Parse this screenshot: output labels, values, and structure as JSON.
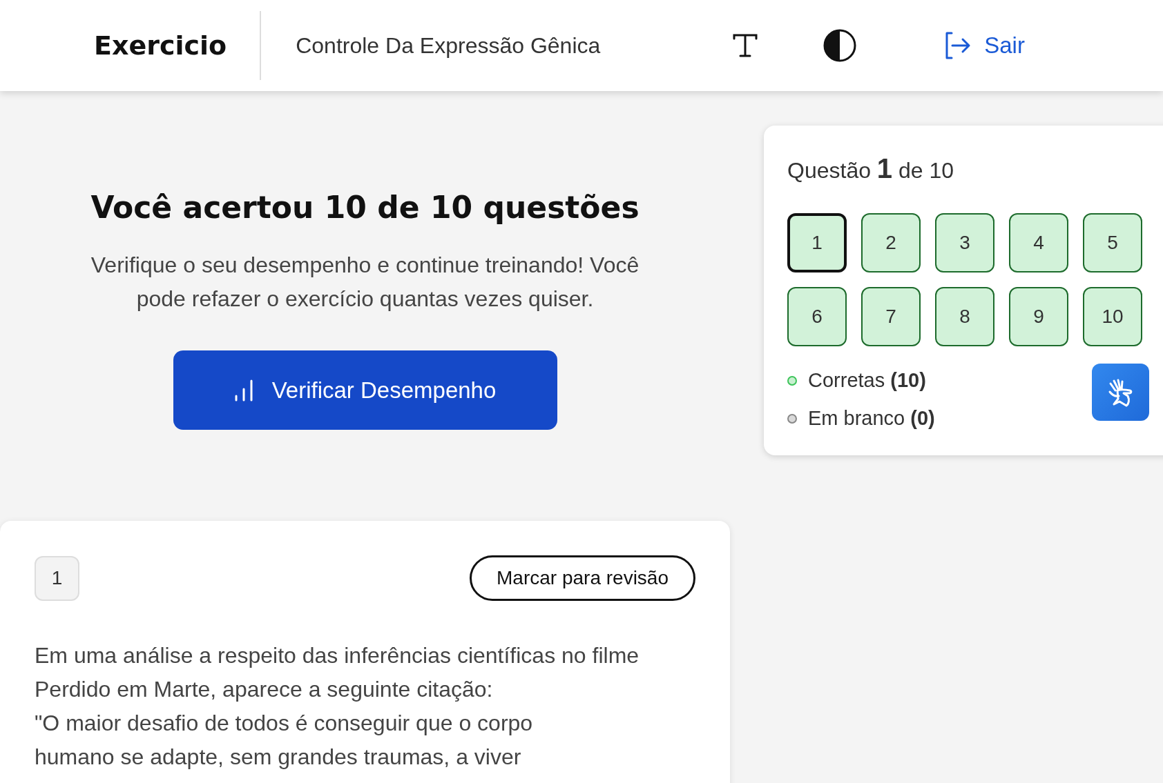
{
  "header": {
    "title": "Exercicio",
    "subtitle": "Controle Da Expressão Gênica",
    "logout": "Sair"
  },
  "result": {
    "heading": "Você acertou 10 de 10 questões",
    "message": "Verifique o seu desempenho e continue treinando! Você pode refazer o exercício quantas vezes quiser.",
    "button": "Verificar Desempenho"
  },
  "navigator": {
    "title": "Questão **1** de 10",
    "questions": [
      {
        "label": "1",
        "selected": true,
        "correct": true
      },
      {
        "label": "2",
        "selected": false,
        "correct": true
      },
      {
        "label": "3",
        "selected": false,
        "correct": true
      },
      {
        "label": "4",
        "selected": false,
        "correct": true
      },
      {
        "label": "5",
        "selected": false,
        "correct": true
      },
      {
        "label": "6",
        "selected": false,
        "correct": true
      },
      {
        "label": "7",
        "selected": false,
        "correct": true
      },
      {
        "label": "8",
        "selected": false,
        "correct": true
      },
      {
        "label": "9",
        "selected": false,
        "correct": true
      },
      {
        "label": "10",
        "selected": false,
        "correct": true
      }
    ],
    "legend": [
      {
        "label": "Corretas **(10)**",
        "color": "#c8f0d0"
      },
      {
        "label": "Em branco **(0)**",
        "color": "#d9d9d9"
      }
    ]
  },
  "question": {
    "number": "1",
    "review_button": "Marcar para revisão",
    "statement_lines": [
      "Em uma análise a respeito das inferências científicas no filme",
      "Perdido em Marte, aparece a seguinte citação:",
      "\"O maior desafio de todos é conseguir que o corpo",
      "humano se adapte, sem grandes traumas, a viver"
    ]
  }
}
